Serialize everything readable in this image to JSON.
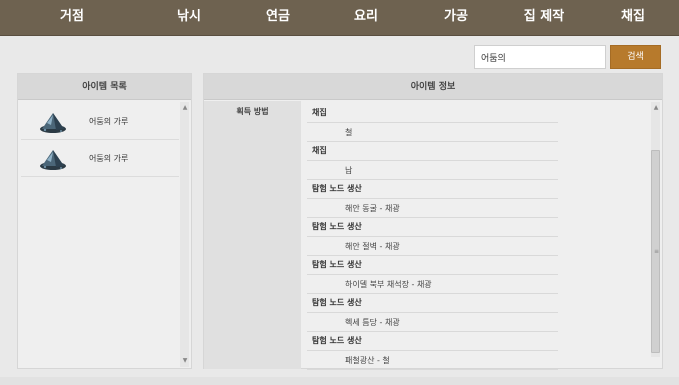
{
  "nav": {
    "items": [
      "거점",
      "낚시",
      "연금",
      "요리",
      "가공",
      "집 제작",
      "채집"
    ]
  },
  "search": {
    "value": "어둠의",
    "button_label": "검색"
  },
  "item_list": {
    "header": "아이템 목록",
    "items": [
      {
        "name": "어둠의 가루",
        "icon": "dark-powder-icon"
      },
      {
        "name": "어둠의 가루",
        "icon": "dark-powder-icon"
      }
    ]
  },
  "item_info": {
    "header": "아이템 정보",
    "acquisition_label": "획득 방법",
    "entries": [
      {
        "type": "채집",
        "detail": "철"
      },
      {
        "type": "채집",
        "detail": "납"
      },
      {
        "type": "탐험 노드 생산",
        "detail": "해안 동굴 - 채광"
      },
      {
        "type": "탐험 노드 생산",
        "detail": "해안 절벽 - 채광"
      },
      {
        "type": "탐험 노드 생산",
        "detail": "하이델 북부 채석장 - 채광"
      },
      {
        "type": "탐험 노드 생산",
        "detail": "헥세 틈당 - 채광"
      },
      {
        "type": "탐험 노드 생산",
        "detail": "패철광산 - 철"
      }
    ]
  },
  "colors": {
    "nav_bg": "#6e6250",
    "accent": "#b77a2c"
  }
}
